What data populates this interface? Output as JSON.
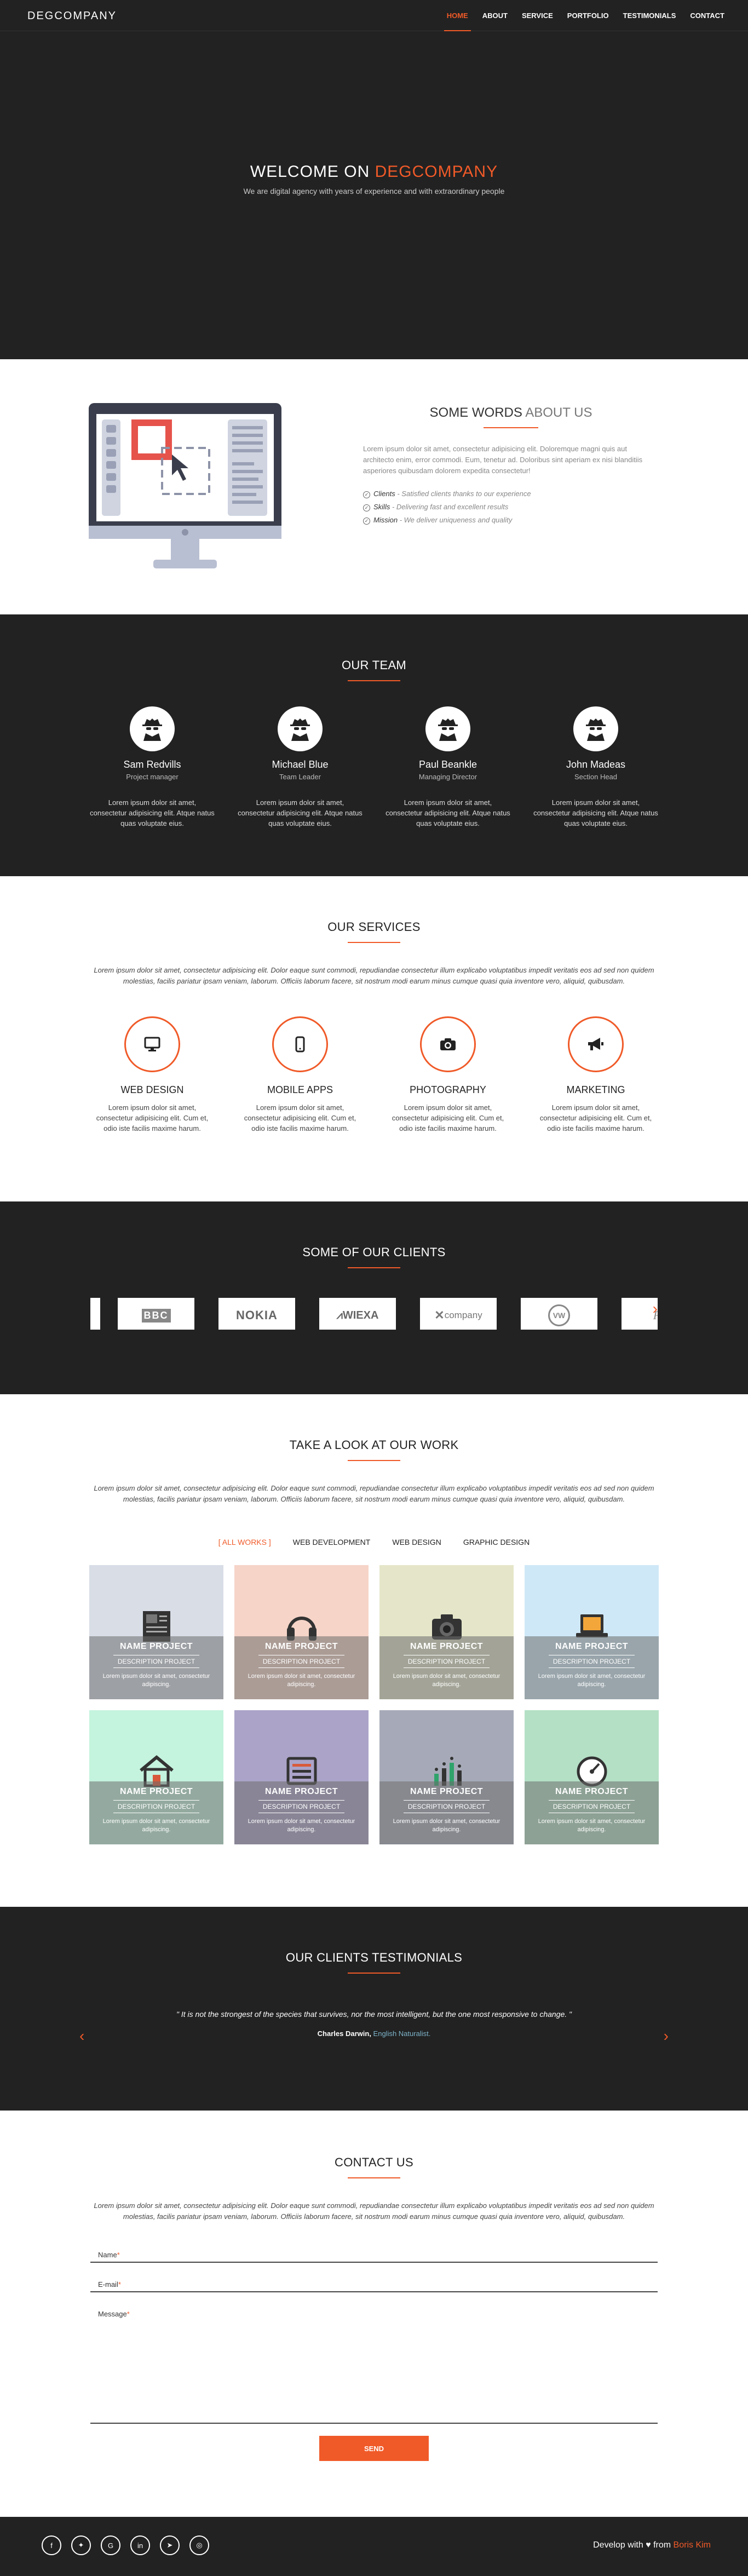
{
  "nav": {
    "brand": "DEGCOMPANY",
    "items": [
      "HOME",
      "ABOUT",
      "SERVICE",
      "PORTFOLIO",
      "TESTIMONIALS",
      "CONTACT"
    ]
  },
  "hero": {
    "title_prefix": "WELCOME ON ",
    "title_accent": "DEGCOMPANY",
    "subtitle": "We are digital agency with years of experience and with extraordinary people"
  },
  "about": {
    "title_strong": "SOME WORDS",
    "title_light": " ABOUT US",
    "text": "Lorem ipsum dolor sit amet, consectetur adipisicing elit. Doloremque magni quis aut architecto enim, error commodi. Eum, tenetur ad. Doloribus sint aperiam ex nisi blanditiis asperiores quibusdam dolorem expedita consectetur!",
    "points": [
      {
        "label": "Clients",
        "text": " - Satisfied clients thanks to our experience"
      },
      {
        "label": "Skills",
        "text": " - Delivering fast and excellent results"
      },
      {
        "label": "Mission",
        "text": " - We deliver uniqueness and quality"
      }
    ]
  },
  "team": {
    "title": "OUR TEAM",
    "members": [
      {
        "name": "Sam Redvills",
        "role": "Project manager",
        "bio": "Lorem ipsum dolor sit amet, consectetur adipisicing elit. Atque natus quas voluptate eius."
      },
      {
        "name": "Michael Blue",
        "role": "Team Leader",
        "bio": "Lorem ipsum dolor sit amet, consectetur adipisicing elit. Atque natus quas voluptate eius."
      },
      {
        "name": "Paul Beankle",
        "role": "Managing Director",
        "bio": "Lorem ipsum dolor sit amet, consectetur adipisicing elit. Atque natus quas voluptate eius."
      },
      {
        "name": "John Madeas",
        "role": "Section Head",
        "bio": "Lorem ipsum dolor sit amet, consectetur adipisicing elit. Atque natus quas voluptate eius."
      }
    ]
  },
  "services": {
    "title": "OUR SERVICES",
    "intro": "Lorem ipsum dolor sit amet, consectetur adipisicing elit. Dolor eaque sunt commodi, repudiandae consectetur illum explicabo voluptatibus impedit veritatis eos ad sed non quidem molestias, facilis pariatur ipsam veniam, laborum. Officiis laborum facere, sit nostrum modi earum minus cumque quasi quia inventore vero, aliquid, quibusdam.",
    "items": [
      {
        "title": "WEB DESIGN",
        "icon": "monitor-icon",
        "text": "Lorem ipsum dolor sit amet, consectetur adipisicing elit. Cum et, odio iste facilis maxime harum."
      },
      {
        "title": "MOBILE APPS",
        "icon": "mobile-icon",
        "text": "Lorem ipsum dolor sit amet, consectetur adipisicing elit. Cum et, odio iste facilis maxime harum."
      },
      {
        "title": "PHOTOGRAPHY",
        "icon": "camera-icon",
        "text": "Lorem ipsum dolor sit amet, consectetur adipisicing elit. Cum et, odio iste facilis maxime harum."
      },
      {
        "title": "MARKETING",
        "icon": "megaphone-icon",
        "text": "Lorem ipsum dolor sit amet, consectetur adipisicing elit. Cum et, odio iste facilis maxime harum."
      }
    ]
  },
  "clients": {
    "title": "SOME OF OUR CLIENTS",
    "logos": [
      "BBC",
      "NOKIA",
      "WIEXA",
      "company",
      "VW",
      "Fo"
    ]
  },
  "portfolio": {
    "title": "TAKE A LOOK AT OUR WORK",
    "intro": "Lorem ipsum dolor sit amet, consectetur adipisicing elit. Dolor eaque sunt commodi, repudiandae consectetur illum explicabo voluptatibus impedit veritatis eos ad sed non quidem molestias, facilis pariatur ipsam veniam, laborum. Officiis laborum facere, sit nostrum modi earum minus cumque quasi quia inventore vero, aliquid, quibusdam.",
    "filters": [
      "[ ALL WORKS ]",
      "WEB DEVELOPMENT",
      "WEB DESIGN",
      "GRAPHIC DESIGN"
    ],
    "cards": [
      {
        "name": "NAME PROJECT",
        "desc": "DESCRIPTION PROJECT",
        "text": "Lorem ipsum dolor sit amet, consectetur adipiscing.",
        "bg": "#d8dde6",
        "icon": "newspaper-icon"
      },
      {
        "name": "NAME PROJECT",
        "desc": "DESCRIPTION PROJECT",
        "text": "Lorem ipsum dolor sit amet, consectetur adipiscing.",
        "bg": "#f6d4c8",
        "icon": "headphones-icon"
      },
      {
        "name": "NAME PROJECT",
        "desc": "DESCRIPTION PROJECT",
        "text": "Lorem ipsum dolor sit amet, consectetur adipiscing.",
        "bg": "#e5e6c9",
        "icon": "camera-icon"
      },
      {
        "name": "NAME PROJECT",
        "desc": "DESCRIPTION PROJECT",
        "text": "Lorem ipsum dolor sit amet, consectetur adipiscing.",
        "bg": "#cfe8f7",
        "icon": "laptop-icon"
      },
      {
        "name": "NAME PROJECT",
        "desc": "DESCRIPTION PROJECT",
        "text": "Lorem ipsum dolor sit amet, consectetur adipiscing.",
        "bg": "#c4f3de",
        "icon": "house-icon"
      },
      {
        "name": "NAME PROJECT",
        "desc": "DESCRIPTION PROJECT",
        "text": "Lorem ipsum dolor sit amet, consectetur adipiscing.",
        "bg": "#aba3c8",
        "icon": "settings-panel-icon"
      },
      {
        "name": "NAME PROJECT",
        "desc": "DESCRIPTION PROJECT",
        "text": "Lorem ipsum dolor sit amet, consectetur adipiscing.",
        "bg": "#a6aab8",
        "icon": "bar-chart-icon"
      },
      {
        "name": "NAME PROJECT",
        "desc": "DESCRIPTION PROJECT",
        "text": "Lorem ipsum dolor sit amet, consectetur adipiscing.",
        "bg": "#b4e0c6",
        "icon": "gauge-icon"
      }
    ]
  },
  "testimonials": {
    "title": "OUR CLIENTS TESTIMONIALS",
    "quote": "\" It is not the strongest of the species that survives, nor the most intelligent, but the one most responsive to change. \"",
    "author": "Charles Darwin,",
    "author_title": " English Naturalist."
  },
  "contact": {
    "title": "CONTACT US",
    "intro": "Lorem ipsum dolor sit amet, consectetur adipisicing elit. Dolor eaque sunt commodi, repudiandae consectetur illum explicabo voluptatibus impedit veritatis eos ad sed non quidem molestias, facilis pariatur ipsam veniam, laborum. Officiis laborum facere, sit nostrum modi earum minus cumque quasi quia inventore vero, aliquid, quibusdam.",
    "name_label": "Name",
    "email_label": "E-mail",
    "message_label": "Message",
    "required": "*",
    "send_label": "SEND"
  },
  "footer": {
    "socials": [
      "facebook-icon",
      "twitter-icon",
      "google-plus-icon",
      "linkedin-icon",
      "telegram-icon",
      "instagram-icon"
    ],
    "credit_prefix": "Develop with ",
    "credit_mid": " from ",
    "credit_author": "Boris Kim"
  },
  "colors": {
    "accent": "#f05a28",
    "dark": "#222222"
  }
}
